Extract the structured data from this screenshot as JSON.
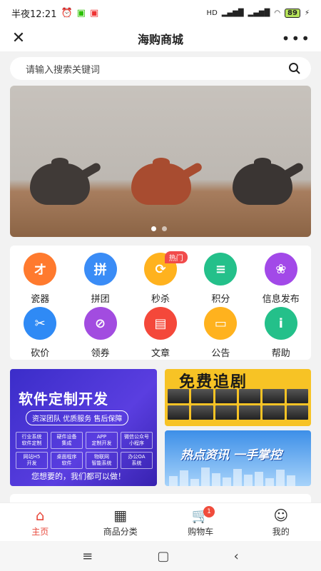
{
  "status_bar": {
    "time": "半夜12:21",
    "battery": "89",
    "network": "HD"
  },
  "header": {
    "title": "海购商城",
    "close": "✕",
    "more": "•••"
  },
  "search": {
    "placeholder": "请输入搜索关键词"
  },
  "banner": {
    "dots": 2,
    "active_dot": 0
  },
  "grid": [
    {
      "label": "瓷器",
      "icon": "porcelain-icon",
      "color": "#ff7a2e",
      "glyph": "オ"
    },
    {
      "label": "拼团",
      "icon": "group-buy-icon",
      "color": "#3a8cf6",
      "glyph": "拼"
    },
    {
      "label": "秒杀",
      "icon": "flash-sale-icon",
      "color": "#ffb21e",
      "glyph": "⟳",
      "badge": "热门"
    },
    {
      "label": "积分",
      "icon": "points-icon",
      "color": "#24c08a",
      "glyph": "≡"
    },
    {
      "label": "信息发布",
      "icon": "publish-icon",
      "color": "#a249e8",
      "glyph": "❀"
    },
    {
      "label": "砍价",
      "icon": "bargain-icon",
      "color": "#2f8af5",
      "glyph": "✂"
    },
    {
      "label": "领券",
      "icon": "coupon-icon",
      "color": "#a24ce0",
      "glyph": "⊘"
    },
    {
      "label": "文章",
      "icon": "article-icon",
      "color": "#f4483a",
      "glyph": "▤"
    },
    {
      "label": "公告",
      "icon": "notice-icon",
      "color": "#ffb21e",
      "glyph": "▭"
    },
    {
      "label": "帮助",
      "icon": "help-icon",
      "color": "#24c08a",
      "glyph": "i"
    }
  ],
  "promo_left": {
    "title": "软件定制开发",
    "subtitle": "资深团队 优质服务 售后保障",
    "tags": [
      "行业系统\n软件定制",
      "硬件设备\n集成",
      "APP\n定制开发",
      "微信公众号\n小程序",
      "网站H5\n开发",
      "桌面程序\n软件",
      "物联网\n智能系统",
      "办公OA\n系统"
    ],
    "footer": "您想要的，我们都可以做！"
  },
  "promo_right_top": {
    "title": "免费追剧"
  },
  "promo_right_bottom": {
    "title": "热点资讯 一手掌控"
  },
  "tabbar": [
    {
      "label": "主页",
      "icon": "home-icon",
      "active": true
    },
    {
      "label": "商品分类",
      "icon": "category-icon"
    },
    {
      "label": "购物车",
      "icon": "cart-icon",
      "badge": "1"
    },
    {
      "label": "我的",
      "icon": "profile-icon"
    }
  ],
  "accent": "#e8473a"
}
